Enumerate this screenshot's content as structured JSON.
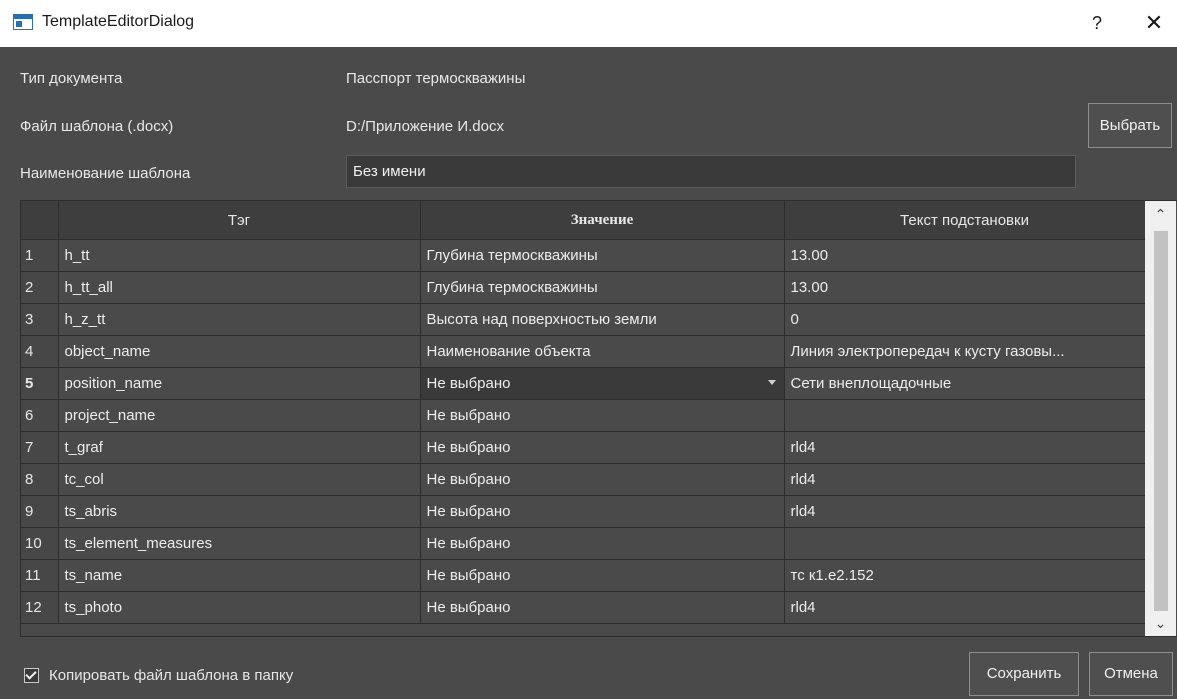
{
  "window": {
    "title": "TemplateEditorDialog",
    "help": "?",
    "close": "✕"
  },
  "form": {
    "doc_type_label": "Тип документа",
    "doc_type_value": "Пасспорт термоскважины",
    "template_file_label": "Файл шаблона (.docx)",
    "template_file_value": "D:/Приложение И.docx",
    "choose_button": "Выбрать",
    "template_name_label": "Наименование шаблона",
    "template_name_value": "Без имени"
  },
  "table": {
    "headers": [
      "Тэг",
      "Значение",
      "Текст подстановки"
    ],
    "rows": [
      {
        "n": "1",
        "tag": "h_tt",
        "value": "Глубина термоскважины",
        "text": "13.00"
      },
      {
        "n": "2",
        "tag": "h_tt_all",
        "value": "Глубина термоскважины",
        "text": "13.00"
      },
      {
        "n": "3",
        "tag": "h_z_tt",
        "value": "Высота над поверхностью земли",
        "text": "0"
      },
      {
        "n": "4",
        "tag": "object_name",
        "value": "Наименование объекта",
        "text": "Линия электропередач к кусту газовы..."
      },
      {
        "n": "5",
        "tag": "position_name",
        "value": "Не выбрано",
        "text": "Сети внеплощадочные"
      },
      {
        "n": "6",
        "tag": "project_name",
        "value": "Не выбрано",
        "text": ""
      },
      {
        "n": "7",
        "tag": "t_graf",
        "value": "Не выбрано",
        "text": "rld4"
      },
      {
        "n": "8",
        "tag": "tc_col",
        "value": "Не выбрано",
        "text": "rld4"
      },
      {
        "n": "9",
        "tag": "ts_abris",
        "value": "Не выбрано",
        "text": "rld4"
      },
      {
        "n": "10",
        "tag": "ts_element_measures",
        "value": "Не выбрано",
        "text": ""
      },
      {
        "n": "11",
        "tag": "ts_name",
        "value": "Не выбрано",
        "text": "тс к1.е2.152"
      },
      {
        "n": "12",
        "tag": "ts_photo",
        "value": "Не выбрано",
        "text": "rld4"
      }
    ],
    "scroll_up": "^",
    "scroll_down": "v"
  },
  "footer": {
    "copy_checkbox_label": "Копировать файл шаблона в папку",
    "copy_checked": true,
    "save_button": "Сохранить",
    "cancel_button": "Отмена"
  },
  "icons": {
    "window_icon": "app-window-icon",
    "combo": "chevron-down-icon"
  }
}
